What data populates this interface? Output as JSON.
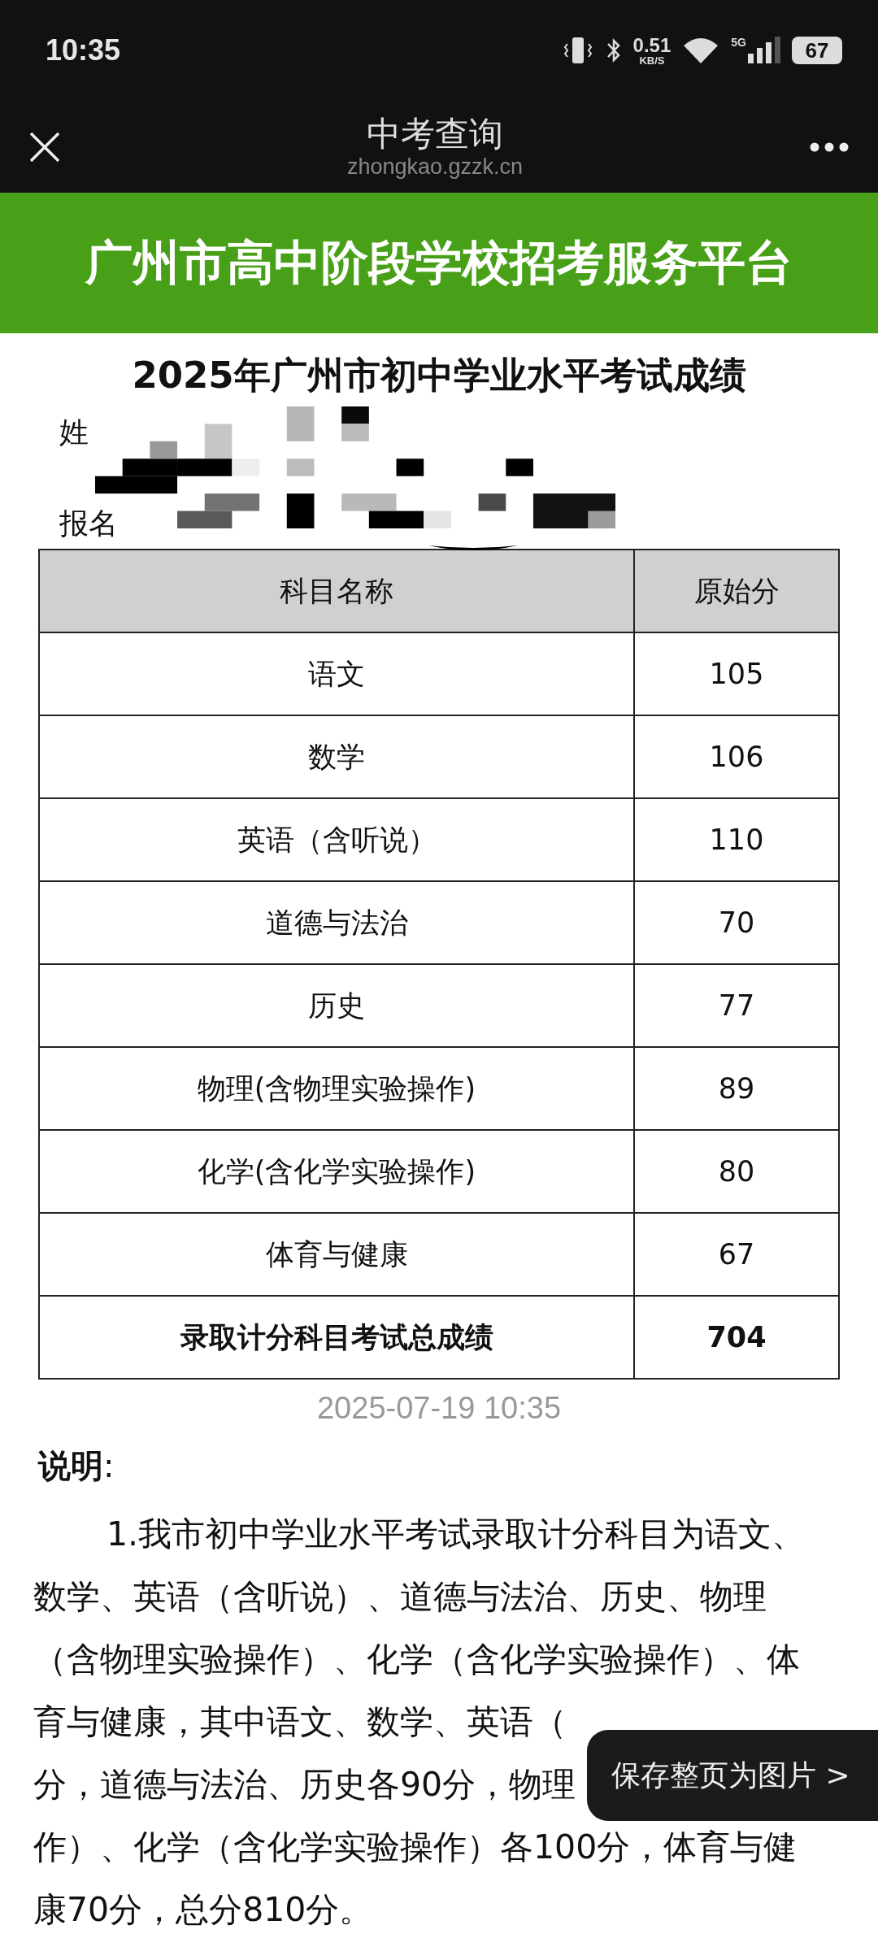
{
  "status_bar": {
    "time": "10:35",
    "net_speed": "0.51",
    "net_unit": "KB/S",
    "network": "5G",
    "battery": "67"
  },
  "title_bar": {
    "title": "中考查询",
    "url": "zhongkao.gzzk.cn"
  },
  "banner": {
    "title": "广州市高中阶段学校招考服务平台"
  },
  "report_title": "2025年广州市初中学业水平考试成绩",
  "info_labels": [
    "姓",
    "报名"
  ],
  "table": {
    "columns": [
      "科目名称",
      "原始分"
    ],
    "rows": [
      {
        "subject": "语文",
        "score": "105",
        "kind": "normal"
      },
      {
        "subject": "数学",
        "score": "106",
        "kind": "normal"
      },
      {
        "subject": "英语（含听说）",
        "score": "110",
        "kind": "normal"
      },
      {
        "subject": "道德与法治",
        "score": "70",
        "kind": "normal"
      },
      {
        "subject": "历史",
        "score": "77",
        "kind": "normal"
      },
      {
        "subject": "物理(含物理实验操作)",
        "score": "89",
        "kind": "normal"
      },
      {
        "subject": "化学(含化学实验操作)",
        "score": "80",
        "kind": "normal"
      },
      {
        "subject": "体育与健康",
        "score": "67",
        "kind": "normal"
      },
      {
        "subject": "录取计分科目考试总成绩",
        "score": "704",
        "kind": "total"
      }
    ]
  },
  "timestamp": "2025-07-19 10:35",
  "notes_heading": "说明",
  "notes_colon": ":",
  "notes_lines": [
    "1.我市初中学业水平考试录取计分科目为语文、",
    "数学、英语（含听说）、道德与法治、历史、物理",
    "（含物理实验操作）、化学（含化学实验操作）、体",
    "育与健康，其中语文、数学、英语（",
    "分，道德与法治、历史各90分，物理",
    "作）、化学（含化学实验操作）各100分，体育与健",
    "康70分，总分810分。"
  ],
  "toast": {
    "label": "保存整页为图片 >"
  }
}
